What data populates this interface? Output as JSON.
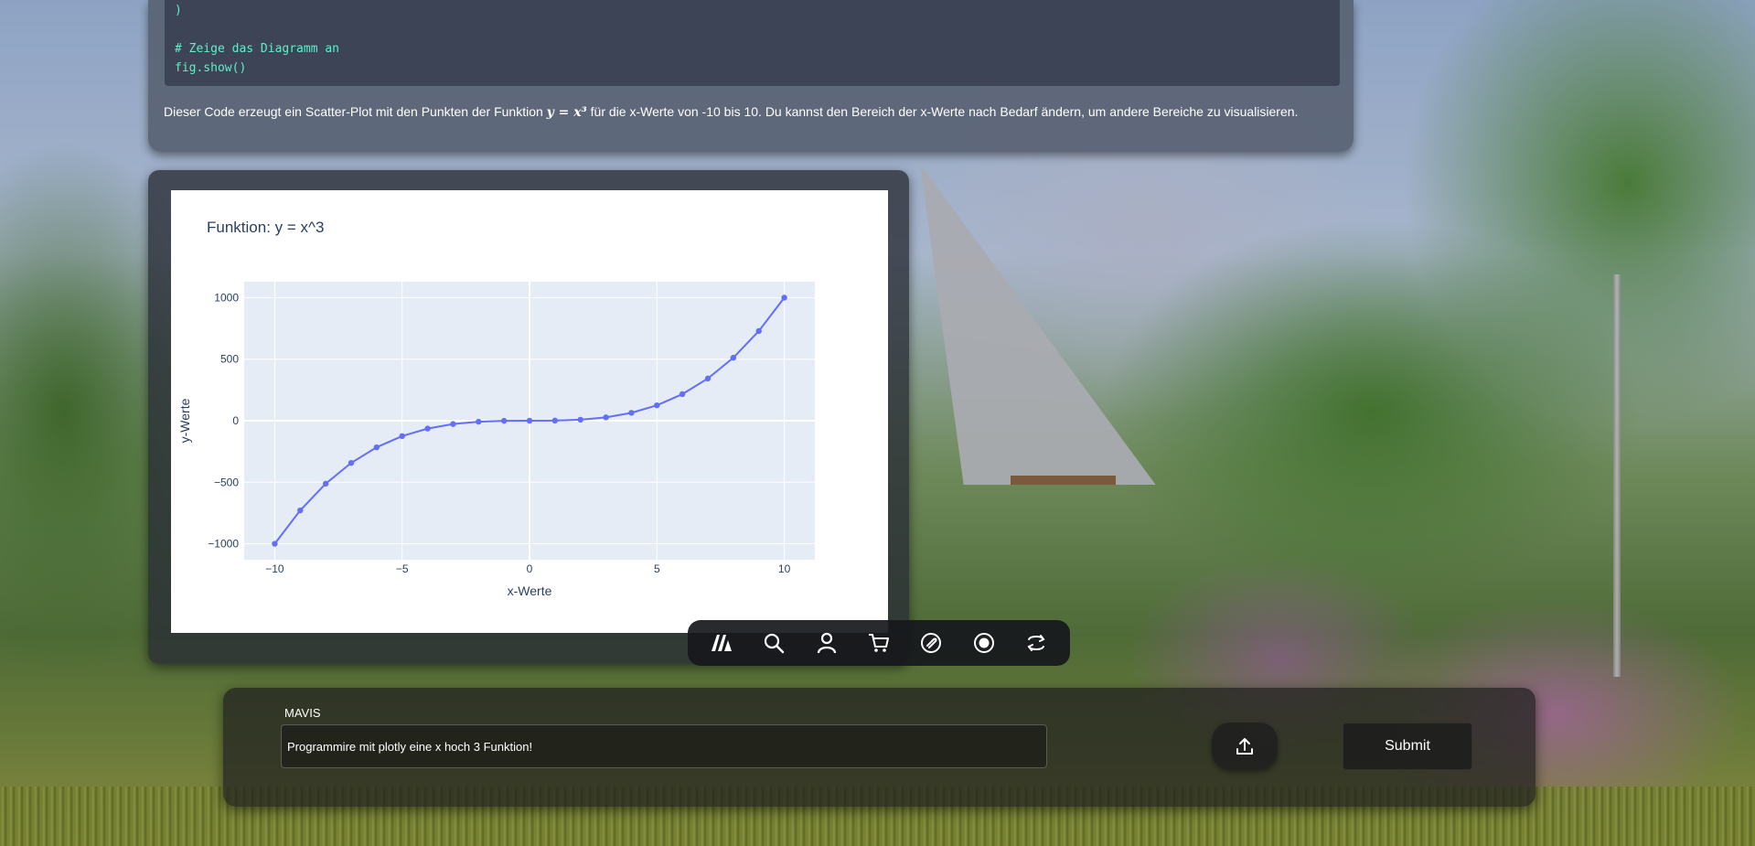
{
  "code": {
    "lines": [
      ")",
      "",
      "# Zeige das Diagramm an",
      "fig.show()"
    ]
  },
  "explanation": {
    "before": "Dieser Code erzeugt ein Scatter-Plot mit den Punkten der Funktion ",
    "math": "y = x³",
    "after": " für die x-Werte von -10 bis 10. Du kannst den Bereich der x-Werte nach Bedarf ändern, um andere Bereiche zu visualisieren."
  },
  "chart_data": {
    "type": "scatter",
    "mode": "lines+markers",
    "title": "Funktion: y = x^3",
    "xlabel": "x-Werte",
    "ylabel": "y-Werte",
    "xlim": [
      -11.2,
      11.2
    ],
    "ylim": [
      -1130,
      1130
    ],
    "xticks": [
      -10,
      -5,
      0,
      5,
      10
    ],
    "xtick_labels": [
      "−10",
      "−5",
      "0",
      "5",
      "10"
    ],
    "yticks": [
      -1000,
      -500,
      0,
      500,
      1000
    ],
    "ytick_labels": [
      "−1000",
      "−500",
      "0",
      "500",
      "1000"
    ],
    "grid": true,
    "color": "#636efa",
    "plot_bg": "#e5ecf6",
    "series": [
      {
        "x": [
          -10,
          -9,
          -8,
          -7,
          -6,
          -5,
          -4,
          -3,
          -2,
          -1,
          0,
          1,
          2,
          3,
          4,
          5,
          6,
          7,
          8,
          9,
          10
        ],
        "y": [
          -1000,
          -729,
          -512,
          -343,
          -216,
          -125,
          -64,
          -27,
          -8,
          -1,
          0,
          1,
          8,
          27,
          64,
          125,
          216,
          343,
          512,
          729,
          1000
        ]
      }
    ]
  },
  "toolbar": {
    "icons": [
      "logo-icon",
      "search-icon",
      "user-icon",
      "cart-icon",
      "attach-icon",
      "record-icon",
      "refresh-icon"
    ]
  },
  "input": {
    "label": "MAVIS",
    "value": "Programmire mit plotly eine x hoch 3 Funktion!",
    "submit_label": "Submit"
  }
}
